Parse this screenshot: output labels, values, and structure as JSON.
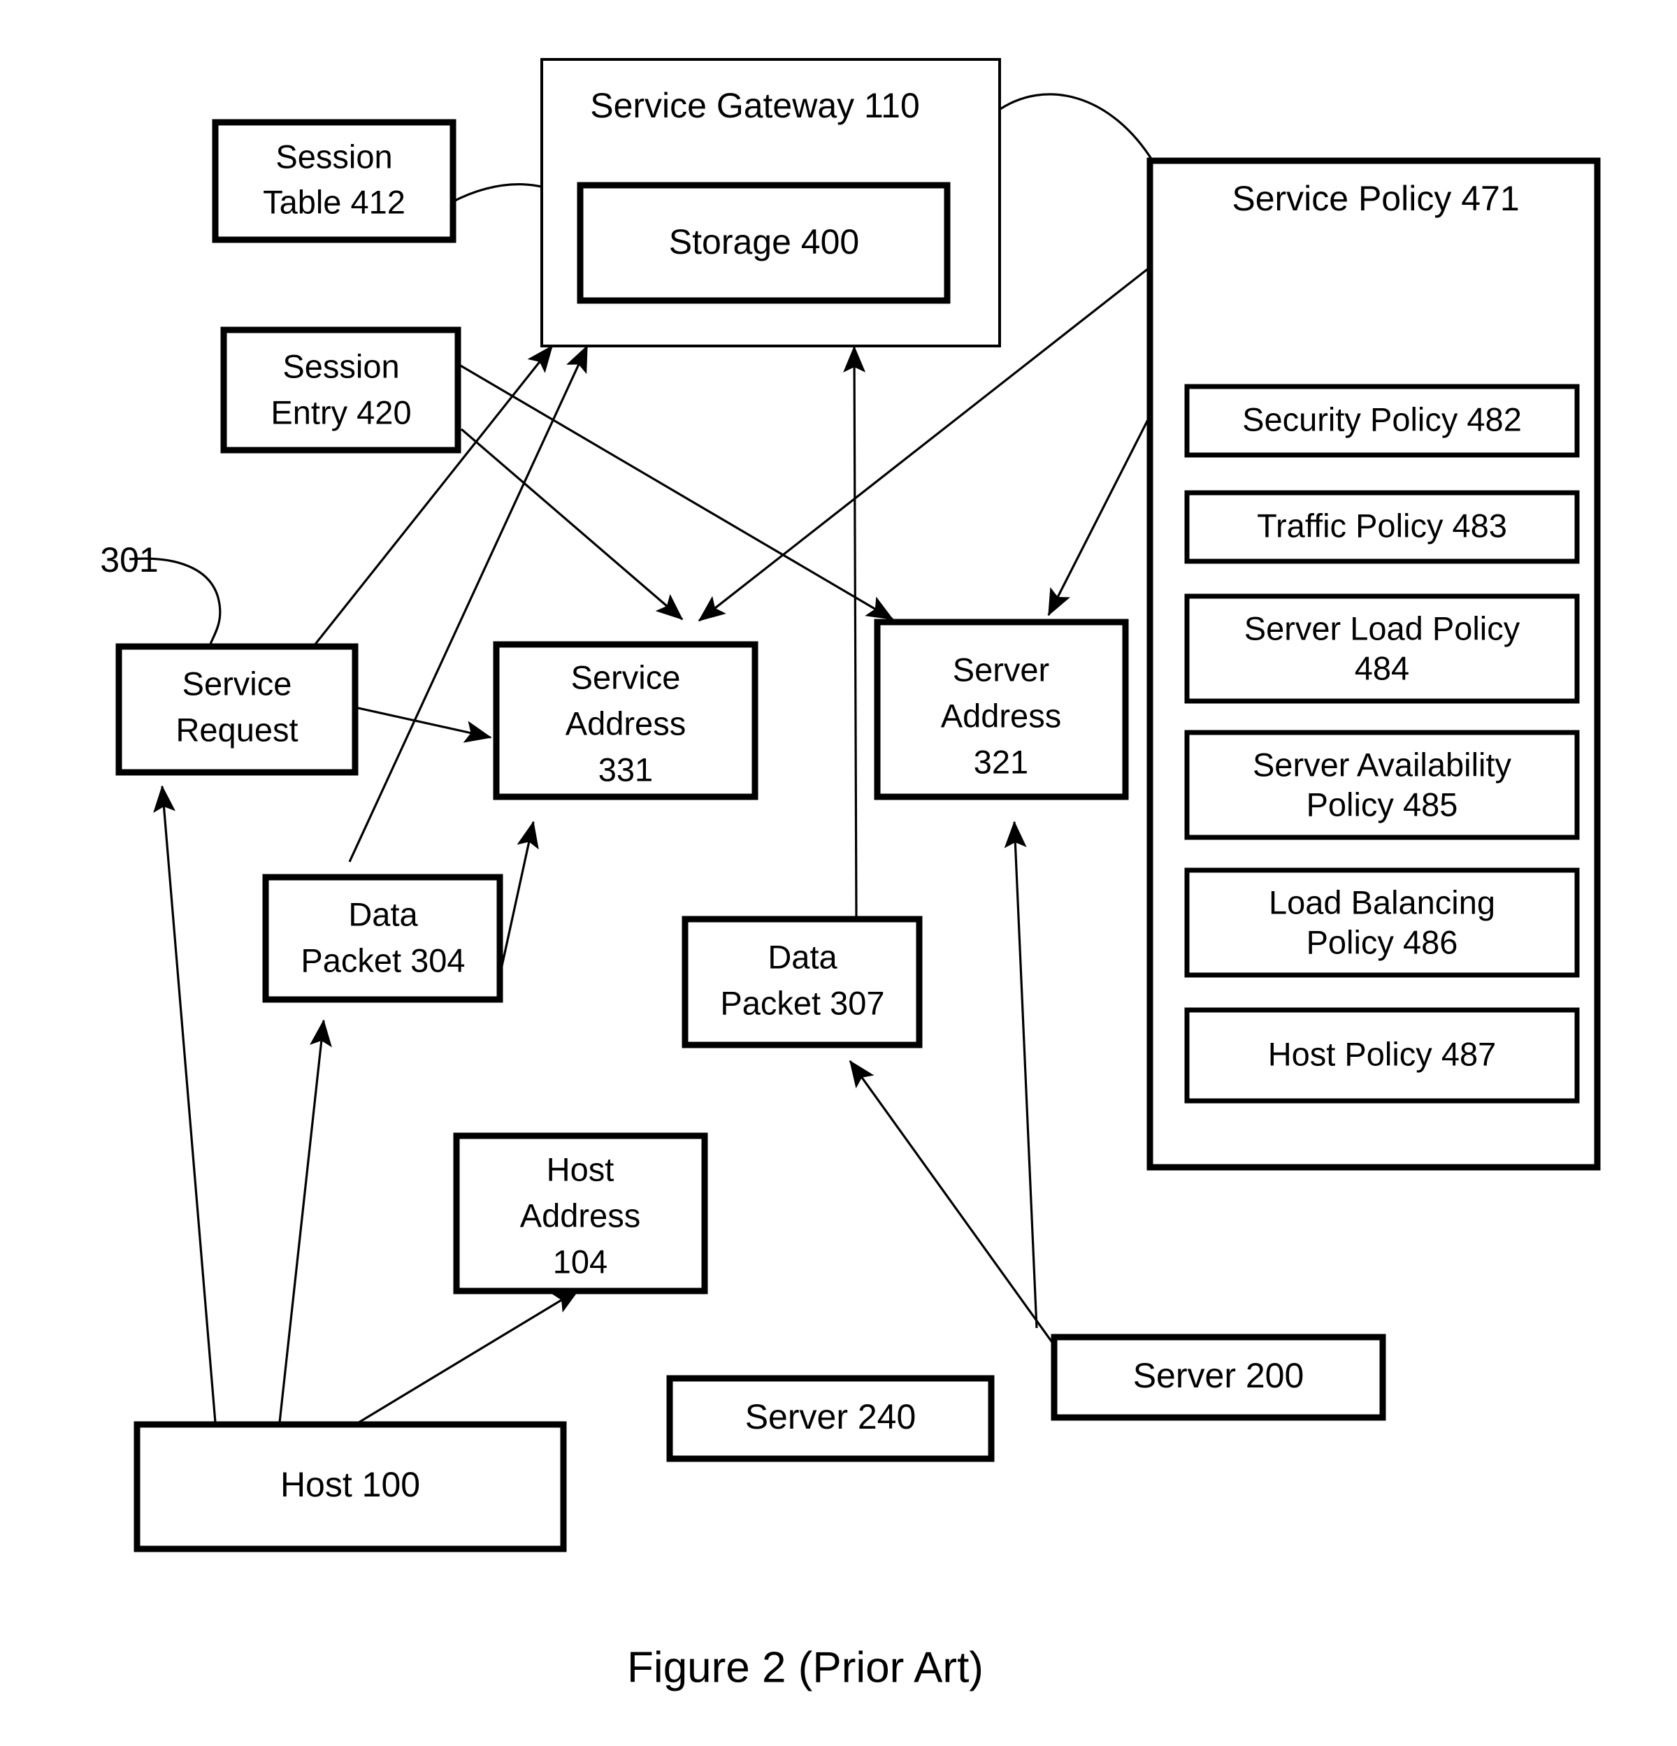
{
  "figure": {
    "caption": "Figure 2 (Prior Art)",
    "reference_numeral": "301"
  },
  "containers": {
    "service_gateway": {
      "label": "Service Gateway 110"
    },
    "storage": {
      "label": "Storage 400"
    },
    "service_policy": {
      "label": "Service Policy 471"
    }
  },
  "policies": [
    {
      "label": "Security Policy 482"
    },
    {
      "label": "Traffic Policy 483"
    },
    {
      "label": "Server Load Policy",
      "label2": "484"
    },
    {
      "label": "Server Availability",
      "label2": "Policy 485"
    },
    {
      "label": "Load Balancing",
      "label2": "Policy 486"
    },
    {
      "label": "Host Policy 487"
    }
  ],
  "nodes": {
    "session_table": {
      "line1": "Session",
      "line2": "Table 412"
    },
    "session_entry": {
      "line1": "Session",
      "line2": "Entry 420"
    },
    "service_request": {
      "line1": "Service",
      "line2": "Request"
    },
    "service_address": {
      "line1": "Service",
      "line2": "Address",
      "line3": "331"
    },
    "server_address": {
      "line1": "Server",
      "line2": "Address",
      "line3": "321"
    },
    "data_packet_304": {
      "line1": "Data",
      "line2": "Packet 304"
    },
    "data_packet_307": {
      "line1": "Data",
      "line2": "Packet 307"
    },
    "host_address": {
      "line1": "Host",
      "line2": "Address",
      "line3": "104"
    },
    "host": {
      "line1": "Host 100"
    },
    "server_240": {
      "line1": "Server 240"
    },
    "server_200": {
      "line1": "Server 200"
    }
  },
  "colors": {
    "stroke": "#000000",
    "fill": "#ffffff"
  }
}
